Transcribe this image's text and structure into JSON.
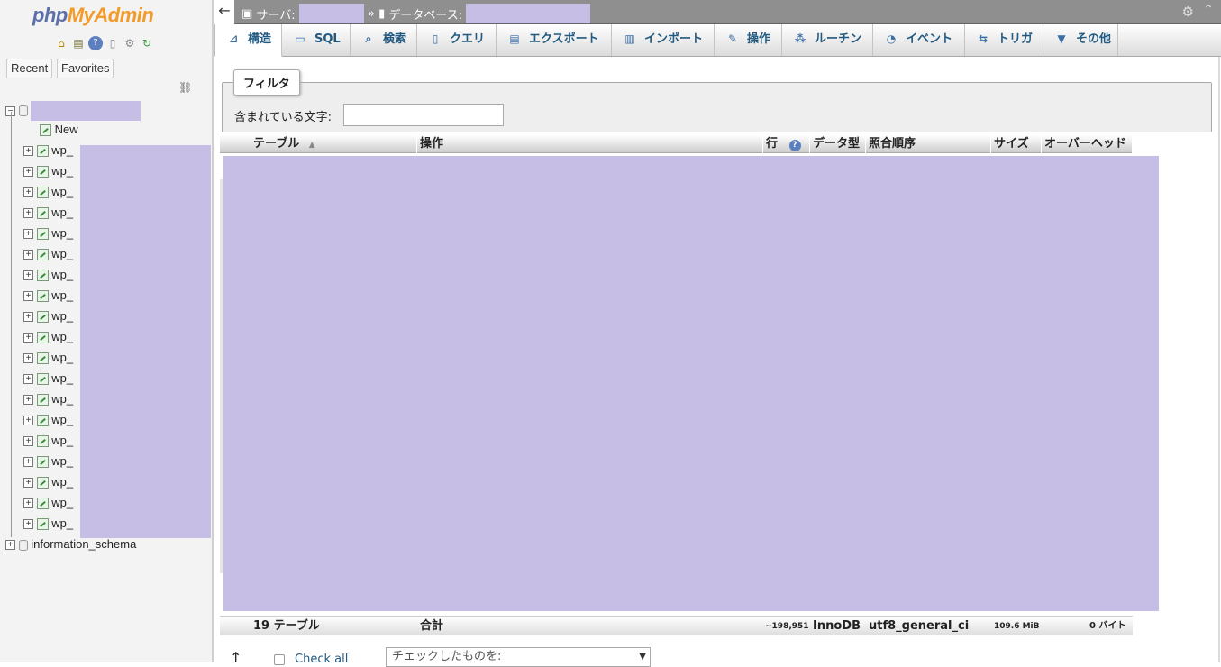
{
  "nav": {
    "logo_php": "php",
    "logo_myadmin": "MyAdmin",
    "icons": [
      "home-icon",
      "exit-icon",
      "help-icon",
      "docs-icon",
      "settings-icon",
      "reload-icon"
    ],
    "recent_label": "Recent",
    "favorites_label": "Favorites",
    "new_label": "New",
    "tables": [
      "wp_",
      "wp_",
      "wp_",
      "wp_",
      "wp_",
      "wp_",
      "wp_",
      "wp_",
      "wp_",
      "wp_",
      "wp_",
      "wp_",
      "wp_",
      "wp_",
      "wp_",
      "wp_",
      "wp_",
      "wp_",
      "wp_"
    ],
    "info_schema": "information_schema"
  },
  "header": {
    "back": "←",
    "server_label": "サーバ:",
    "sep": "»",
    "database_label": "データベース:"
  },
  "tabs": [
    {
      "label": "構造",
      "icon": "structure-icon"
    },
    {
      "label": "SQL",
      "icon": "sql-icon"
    },
    {
      "label": "検索",
      "icon": "search-icon"
    },
    {
      "label": "クエリ",
      "icon": "query-icon"
    },
    {
      "label": "エクスポート",
      "icon": "export-icon"
    },
    {
      "label": "インポート",
      "icon": "import-icon"
    },
    {
      "label": "操作",
      "icon": "wrench-icon"
    },
    {
      "label": "ルーチン",
      "icon": "routines-icon"
    },
    {
      "label": "イベント",
      "icon": "clock-icon"
    },
    {
      "label": "トリガ",
      "icon": "triggers-icon"
    },
    {
      "label": "その他",
      "icon": "more-icon"
    }
  ],
  "filter": {
    "legend": "フィルタ",
    "label": "含まれている文字:",
    "value": ""
  },
  "table": {
    "headers": {
      "table": "テーブル",
      "action": "操作",
      "rows": "行",
      "type": "データ型",
      "collation": "照合順序",
      "size": "サイズ",
      "overhead": "オーバーヘッド"
    },
    "footer": {
      "count": "19 テーブル",
      "total": "合計",
      "rows": "~198,951",
      "engine": "InnoDB",
      "collation": "utf8_general_ci",
      "size": "109.6 MiB",
      "overhead": "0 バイト"
    }
  },
  "bottom": {
    "check_all": "Check all",
    "with_selected": "チェックしたものを:"
  }
}
